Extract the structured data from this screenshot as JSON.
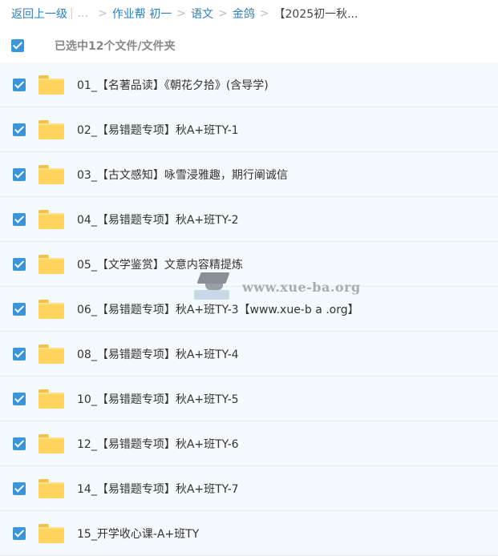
{
  "breadcrumb": {
    "back": "返回上一级",
    "divider": "|",
    "ellipsis": "...",
    "sep": ">",
    "items": [
      "作业帮 初一",
      "语文",
      "金鸽"
    ],
    "current": "【2025初一秋..."
  },
  "selection": {
    "label": "已选中12个文件/文件夹",
    "checked": true
  },
  "files": [
    {
      "name": "01_【名著品读】《朝花夕拾》(含导学)",
      "checked": true,
      "icon": "folder-icon"
    },
    {
      "name": "02_【易错题专项】秋A+班TY-1",
      "checked": true,
      "icon": "folder-icon"
    },
    {
      "name": "03_【古文感知】咏雪浸雅趣，期行阐诚信",
      "checked": true,
      "icon": "folder-icon"
    },
    {
      "name": "04_【易错题专项】秋A+班TY-2",
      "checked": true,
      "icon": "folder-icon"
    },
    {
      "name": "05_【文学鉴赏】文意内容精提炼",
      "checked": true,
      "icon": "folder-icon"
    },
    {
      "name": "06_【易错题专项】秋A+班TY-3【www.xue-b a .org】",
      "checked": true,
      "icon": "folder-icon"
    },
    {
      "name": "08_【易错题专项】秋A+班TY-4",
      "checked": true,
      "icon": "folder-icon"
    },
    {
      "name": "10_【易错题专项】秋A+班TY-5",
      "checked": true,
      "icon": "folder-icon"
    },
    {
      "name": "12_【易错题专项】秋A+班TY-6",
      "checked": true,
      "icon": "folder-icon"
    },
    {
      "name": "14_【易错题专项】秋A+班TY-7",
      "checked": true,
      "icon": "folder-icon"
    },
    {
      "name": "15_开学收心课-A+班TY",
      "checked": true,
      "icon": "folder-icon"
    }
  ],
  "watermark": {
    "text": "www.xue-ba.org"
  },
  "colors": {
    "accent": "#3b95d9",
    "row_bg": "#f3f9fd",
    "folder": "#ffd45c"
  }
}
